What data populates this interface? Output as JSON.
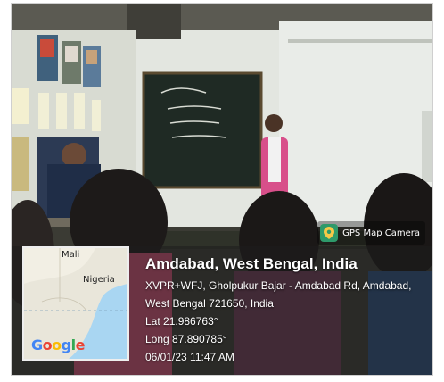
{
  "badge": {
    "label": "GPS Map Camera",
    "icon": "map-pin-icon"
  },
  "location": {
    "title": "Amdabad, West Bengal, India",
    "address_line1": "XVPR+WFJ, Gholpukur Bajar - Amdabad Rd, Amdabad,",
    "address_line2": "West Bengal 721650, India",
    "lat": "Lat 21.986763°",
    "long": "Long 87.890785°",
    "datetime": "06/01/23 11:47 AM"
  },
  "map": {
    "labels": [
      "Mali",
      "Nigeria"
    ],
    "logo_letters": [
      "G",
      "o",
      "o",
      "g",
      "l",
      "e"
    ],
    "logo_colors": [
      "#4285F4",
      "#EA4335",
      "#FBBC05",
      "#4285F4",
      "#34A853",
      "#EA4335"
    ]
  },
  "colors": {
    "overlay": "#1e1e1e",
    "board": "#1f2a24",
    "wall": "#e8ebe6"
  }
}
